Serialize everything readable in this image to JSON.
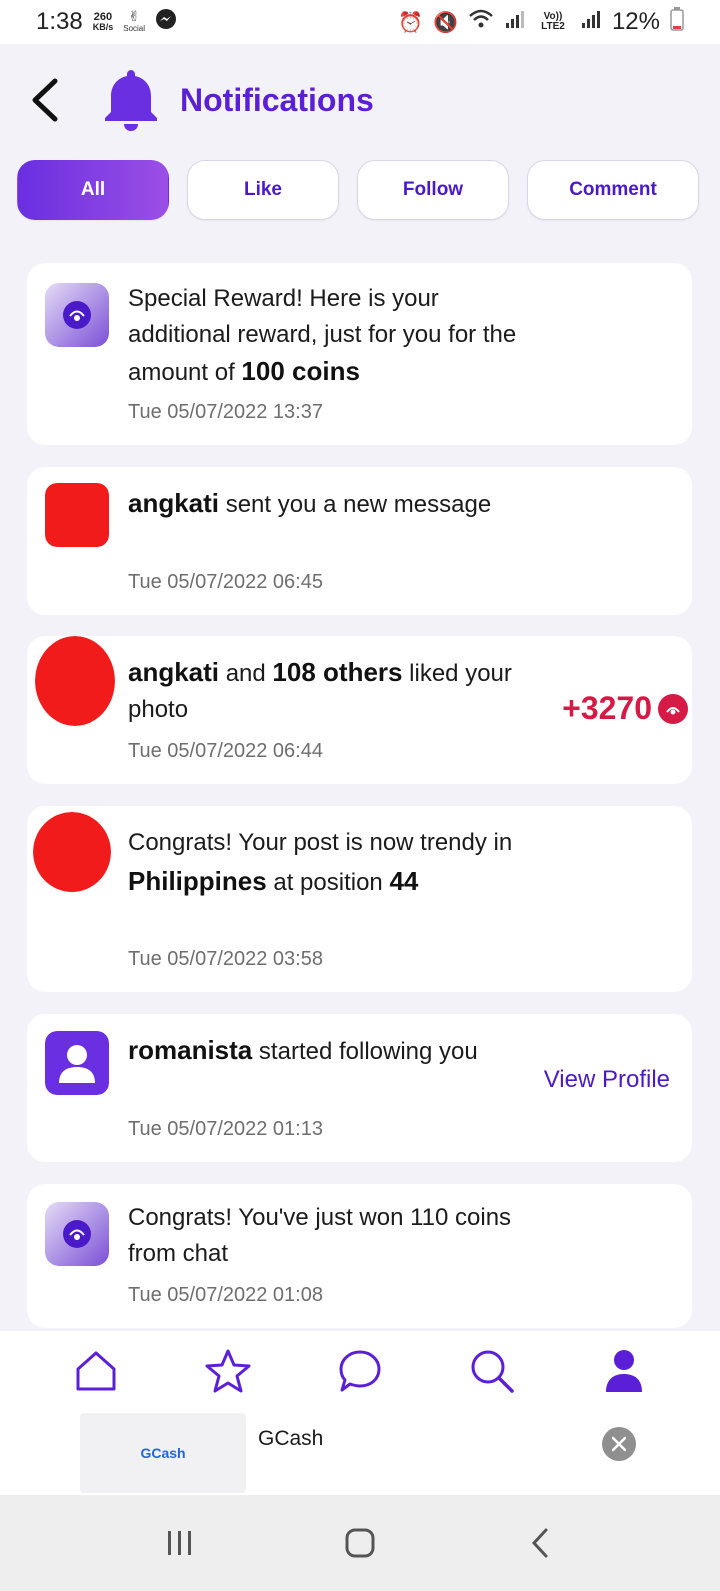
{
  "status_bar": {
    "time": "1:38",
    "speed_value": "260",
    "speed_unit": "KB/s",
    "social_label": "Social",
    "network_label": "Vo)) LTE2",
    "battery": "12%"
  },
  "header": {
    "title": "Notifications"
  },
  "tabs": [
    {
      "label": "All",
      "active": true
    },
    {
      "label": "Like",
      "active": false
    },
    {
      "label": "Follow",
      "active": false
    },
    {
      "label": "Comment",
      "active": false
    }
  ],
  "notifications": [
    {
      "text_pre": "Special Reward! Here is your additional reward, just for you for the amount of ",
      "text_bold": "100 coins",
      "time": "Tue 05/07/2022 13:37"
    },
    {
      "user": "angkati",
      "text": " sent you a new message",
      "time": "Tue 05/07/2022 06:45"
    },
    {
      "user": "angkati",
      "text_mid": " and ",
      "others": "108 others",
      "text_end": " liked your photo",
      "coins": "+3270",
      "time": "Tue 05/07/2022 06:44"
    },
    {
      "text_pre": "Congrats! Your post is now trendy in ",
      "country": "Philippines",
      "text_mid": " at position ",
      "position": "44",
      "time": "Tue 05/07/2022 03:58"
    },
    {
      "user": "romanista",
      "text": " started following you",
      "action": "View Profile",
      "time": "Tue 05/07/2022 01:13"
    },
    {
      "text": "Congrats! You've just won 110 coins from chat",
      "time": "Tue 05/07/2022 01:08"
    }
  ],
  "ad": {
    "title": "GCash",
    "thumb_label": "GCash"
  },
  "colors": {
    "accent": "#5a1fd6",
    "coin_red": "#d41a45",
    "background": "#f3f2f8"
  }
}
